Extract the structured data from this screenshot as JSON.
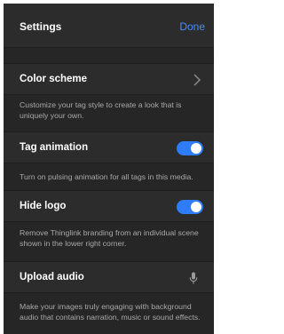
{
  "header": {
    "title": "Settings",
    "done_label": "Done"
  },
  "settings": [
    {
      "label": "Color scheme",
      "description": "Customize your tag style to create a look that is uniquely your own.",
      "control": "chevron-right-icon"
    },
    {
      "label": "Tag animation",
      "description": "Turn on pulsing animation for all tags in this media.",
      "control": "toggle",
      "enabled": true
    },
    {
      "label": "Hide logo",
      "description": "Remove Thinglink branding from an individual scene shown in the lower right corner.",
      "control": "toggle",
      "enabled": true
    },
    {
      "label": "Upload audio",
      "description": "Make your images truly engaging with background audio that contains narration, music or sound effects.",
      "control": "microphone-icon"
    }
  ],
  "colors": {
    "panel_bg": "#262626",
    "row_bg": "#2c2c2c",
    "accent": "#2e7cf6",
    "done_link": "#4a8dff",
    "description_text": "#a9a9a9"
  }
}
